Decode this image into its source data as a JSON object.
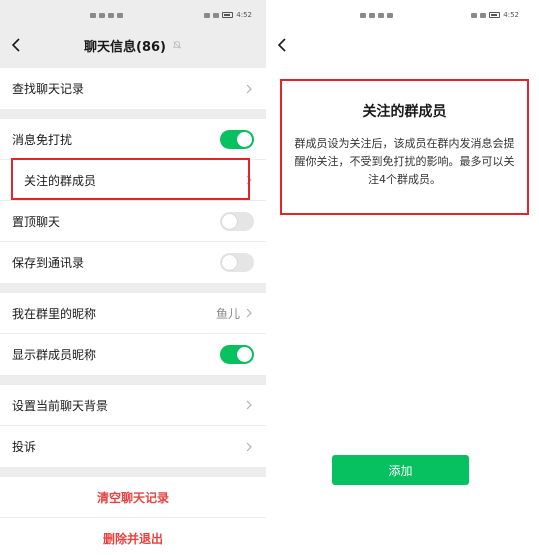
{
  "status_bar": {
    "time": "4:52"
  },
  "left": {
    "nav_title": "聊天信息(86)",
    "rows": {
      "search_history": "查找聊天记录",
      "mute": "消息免打扰",
      "follow_members": "关注的群成员",
      "pin": "置顶聊天",
      "save_contacts": "保存到通讯录",
      "nickname": "我在群里的昵称",
      "nickname_value": "鱼儿",
      "show_nicknames": "显示群成员昵称",
      "background": "设置当前聊天背景",
      "complaint": "投诉"
    },
    "toggles": {
      "mute": "on",
      "pin": "off",
      "save_contacts": "off",
      "show_nicknames": "on"
    },
    "clear_history": "清空聊天记录",
    "delete_exit": "删除并退出"
  },
  "right": {
    "title": "关注的群成员",
    "description": "群成员设为关注后，该成员在群内发消息会提醒你关注，不受到免打扰的影响。最多可以关注4个群成员。",
    "add_button": "添加"
  },
  "colors": {
    "accent": "#07c160",
    "danger": "#e64340",
    "highlight": "#e0262b"
  }
}
